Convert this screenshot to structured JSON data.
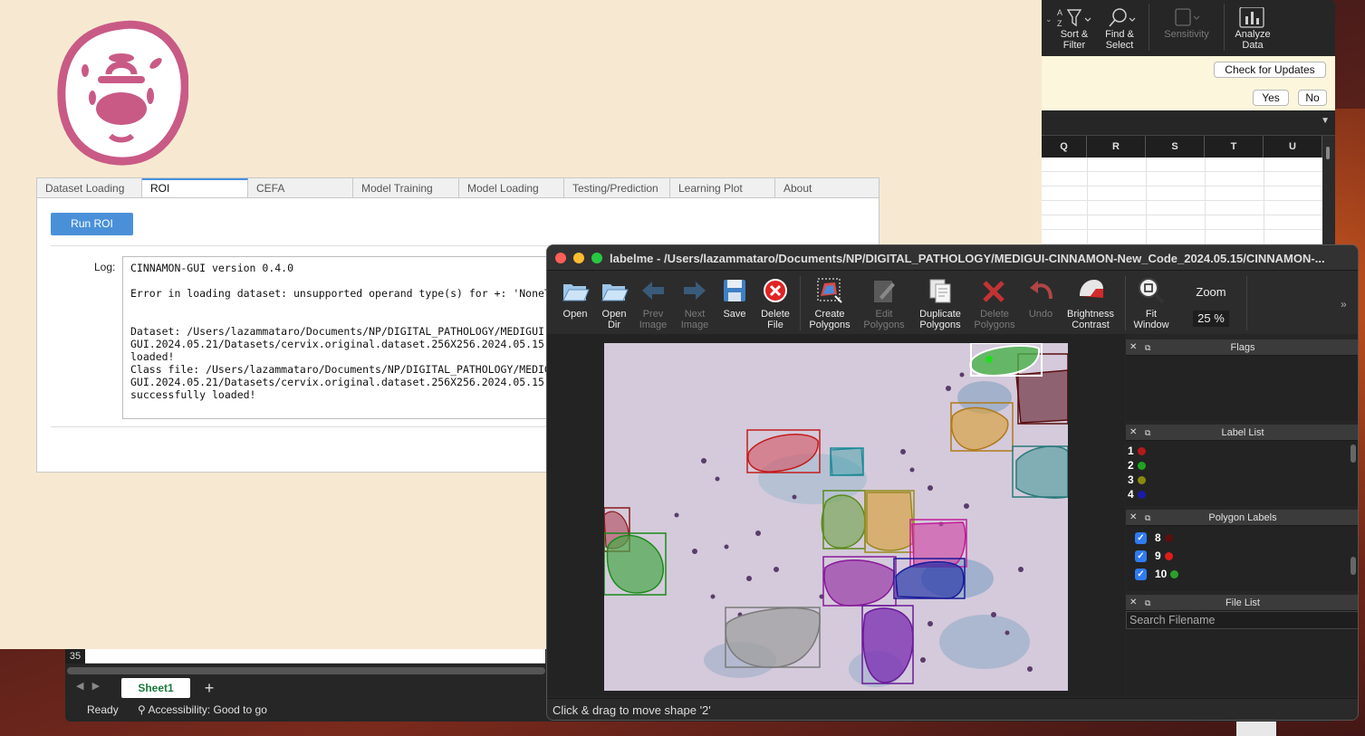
{
  "excel": {
    "ribbon": {
      "sort_filter": "Sort &\nFilter",
      "find_select": "Find &\nSelect",
      "sensitivity": "Sensitivity",
      "analyze_data": "Analyze\nData"
    },
    "message": {
      "check_updates": "Check for Updates",
      "yes": "Yes",
      "no": "No"
    },
    "columns": [
      "Q",
      "R",
      "S",
      "T",
      "U"
    ],
    "row_number": "35",
    "sheet_tab": "Sheet1",
    "add_sheet": "+",
    "status_ready": "Ready",
    "status_accessibility": "Accessibility: Good to go"
  },
  "cinnamon": {
    "tabs": [
      "Dataset Loading",
      "ROI",
      "CEFA",
      "Model Training",
      "Model Loading",
      "Testing/Prediction",
      "Learning Plot",
      "About"
    ],
    "active_tab": "ROI",
    "run_roi": "Run ROI",
    "log_label": "Log:",
    "log_text": "CINNAMON-GUI version 0.4.0\n\nError in loading dataset: unsupported operand type(s) for +: 'NoneType' and 'str'\n\n\nDataset: /Users/lazammataro/Documents/NP/DIGITAL_PATHOLOGY/MEDIGUI-CINNAMON-New_Code_2024.05.15/CINNAMON-\nGUI.2024.05.21/Datasets/cervix.original.dataset.256X256.2024.05.15.pickle successfully\nloaded!\nClass file: /Users/lazammataro/Documents/NP/DIGITAL_PATHOLOGY/MEDIGUI-CINNAMON-New_Code_2024.05.15/CINNAMON-\nGUI.2024.05.21/Datasets/cervix.original.dataset.256X256.2024.05.15.classes.pickle\nsuccessfully loaded!",
    "colors": {
      "accent": "#4a90d9",
      "logo": "#c95a86",
      "background": "#f7e9d1"
    }
  },
  "labelme": {
    "title": "labelme - /Users/lazammataro/Documents/NP/DIGITAL_PATHOLOGY/MEDIGUI-CINNAMON-New_Code_2024.05.15/CINNAMON-...",
    "toolbar": [
      {
        "label": "Open",
        "icon": "folder-open-icon",
        "enabled": true
      },
      {
        "label": "Open\nDir",
        "icon": "folder-dir-icon",
        "enabled": true
      },
      {
        "label": "Prev\nImage",
        "icon": "arrow-left-icon",
        "enabled": false
      },
      {
        "label": "Next\nImage",
        "icon": "arrow-right-icon",
        "enabled": false
      },
      {
        "label": "Save",
        "icon": "save-icon",
        "enabled": true
      },
      {
        "label": "Delete\nFile",
        "icon": "delete-file-icon",
        "enabled": true
      },
      {
        "label": "Create\nPolygons",
        "icon": "create-polygon-icon",
        "enabled": true
      },
      {
        "label": "Edit\nPolygons",
        "icon": "edit-polygon-icon",
        "enabled": false
      },
      {
        "label": "Duplicate\nPolygons",
        "icon": "duplicate-icon",
        "enabled": true
      },
      {
        "label": "Delete\nPolygons",
        "icon": "delete-polygon-icon",
        "enabled": false
      },
      {
        "label": "Undo",
        "icon": "undo-icon",
        "enabled": false
      },
      {
        "label": "Brightness\nContrast",
        "icon": "brightness-icon",
        "enabled": true
      },
      {
        "label": "Fit\nWindow",
        "icon": "fit-window-icon",
        "enabled": true
      }
    ],
    "zoom_label": "Zoom",
    "zoom_value": "25 %",
    "docks": {
      "flags": "Flags",
      "label_list": "Label List",
      "polygon_labels": "Polygon Labels",
      "file_list": "File List"
    },
    "label_list": [
      {
        "name": "1",
        "color": "#b41a1a"
      },
      {
        "name": "2",
        "color": "#1fa31f"
      },
      {
        "name": "3",
        "color": "#8a8a12"
      },
      {
        "name": "4",
        "color": "#1a1aa8"
      }
    ],
    "polygon_labels": [
      {
        "name": "8",
        "color": "#5a0f0f"
      },
      {
        "name": "9",
        "color": "#e01b1b"
      },
      {
        "name": "10",
        "color": "#2aa12a"
      }
    ],
    "search_placeholder": "Search Filename",
    "status": "Click & drag to move shape '2'"
  }
}
